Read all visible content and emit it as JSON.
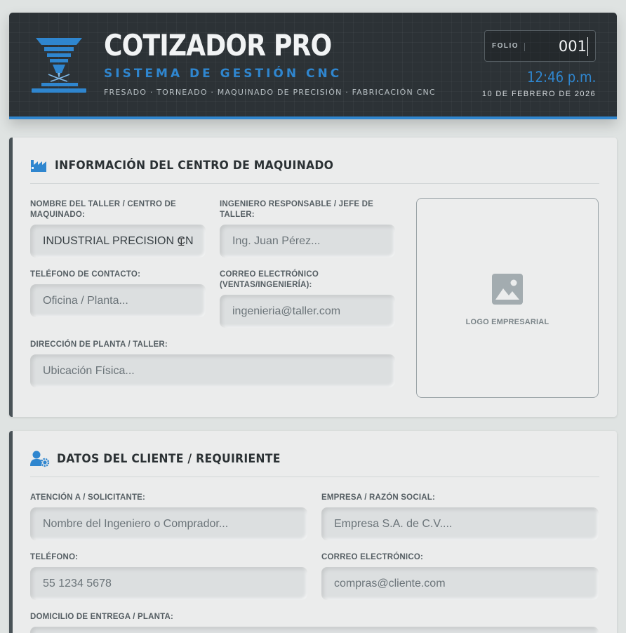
{
  "header": {
    "title": "COTIZADOR PRO",
    "subtitle": "SISTEMA DE GESTIÓN CNC",
    "tags": "FRESADO · TORNEADO · MAQUINADO DE PRECISIÓN · FABRICACIÓN CNC",
    "folio_label": "FOLIO",
    "folio_value": "001",
    "time": "12:46 p.m.",
    "date": "10 DE FEBRERO DE 2026",
    "accent_color": "#2f86cf",
    "logo_icon": "cnc-machine-icon"
  },
  "workshop": {
    "section_title": "INFORMACIÓN DEL CENTRO DE MAQUINADO",
    "section_icon": "factory-icon",
    "name_label": "NOMBRE DEL TALLER / CENTRO DE MAQUINADO:",
    "name_value": "INDUSTRIAL PRECISION CNC.",
    "engineer_label": "INGENIERO RESPONSABLE / JEFE DE TALLER:",
    "engineer_placeholder": "Ing. Juan Pérez...",
    "phone_label": "TELÉFONO DE CONTACTO:",
    "phone_placeholder": "Oficina / Planta...",
    "email_label": "CORREO ELECTRÓNICO (VENTAS/INGENIERÍA):",
    "email_placeholder": "ingenieria@taller.com",
    "address_label": "DIRECCIÓN DE PLANTA / TALLER:",
    "address_placeholder": "Ubicación Física...",
    "logo_label": "LOGO EMPRESARIAL",
    "logo_icon": "image-icon"
  },
  "client": {
    "section_title": "DATOS DEL CLIENTE / REQUIRIENTE",
    "section_icon": "user-gear-icon",
    "attention_label": "ATENCIÓN A / SOLICITANTE:",
    "attention_placeholder": "Nombre del Ingeniero o Comprador...",
    "company_label": "EMPRESA / RAZÓN SOCIAL:",
    "company_placeholder": "Empresa S.A. de C.V....",
    "phone_label": "TELÉFONO:",
    "phone_placeholder": "55 1234 5678",
    "email_label": "CORREO ELECTRÓNICO:",
    "email_placeholder": "compras@cliente.com",
    "address_label": "DOMICILIO DE ENTREGA / PLANTA:"
  }
}
